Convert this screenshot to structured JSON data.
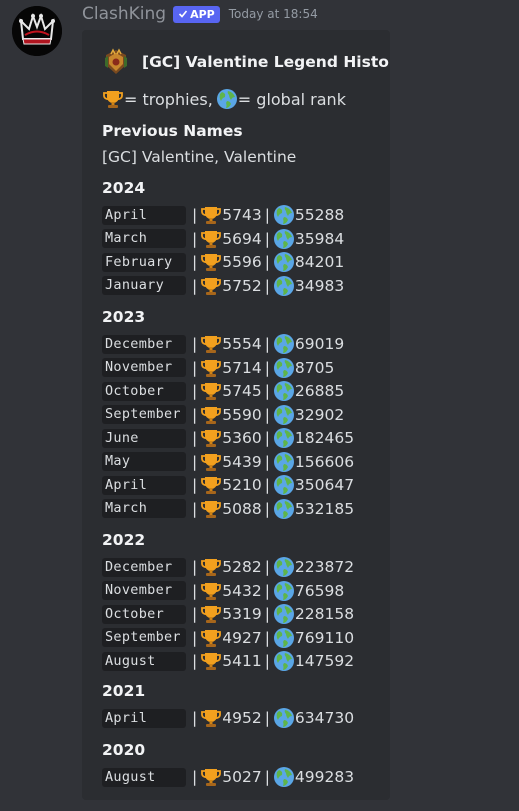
{
  "message": {
    "username": "ClashKing",
    "app_badge": "APP",
    "timestamp": "Today at 18:54"
  },
  "embed": {
    "title": "[GC] Valentine Legend History",
    "legend_trophies": "= trophies,",
    "legend_global": "= global rank",
    "previous_names_heading": "Previous Names",
    "previous_names": "[GC] Valentine, Valentine"
  },
  "history": [
    {
      "year": "2024",
      "rows": [
        {
          "month": "April",
          "trophies": "5743",
          "rank": "55288"
        },
        {
          "month": "March",
          "trophies": "5694",
          "rank": "35984"
        },
        {
          "month": "February",
          "trophies": "5596",
          "rank": "84201"
        },
        {
          "month": "January",
          "trophies": "5752",
          "rank": "34983"
        }
      ]
    },
    {
      "year": "2023",
      "rows": [
        {
          "month": "December",
          "trophies": "5554",
          "rank": "69019"
        },
        {
          "month": "November",
          "trophies": "5714",
          "rank": "8705"
        },
        {
          "month": "October",
          "trophies": "5745",
          "rank": "26885"
        },
        {
          "month": "September",
          "trophies": "5590",
          "rank": "32902"
        },
        {
          "month": "June",
          "trophies": "5360",
          "rank": "182465"
        },
        {
          "month": "May",
          "trophies": "5439",
          "rank": "156606"
        },
        {
          "month": "April",
          "trophies": "5210",
          "rank": "350647"
        },
        {
          "month": "March",
          "trophies": "5088",
          "rank": "532185"
        }
      ]
    },
    {
      "year": "2022",
      "rows": [
        {
          "month": "December",
          "trophies": "5282",
          "rank": "223872"
        },
        {
          "month": "November",
          "trophies": "5432",
          "rank": "76598"
        },
        {
          "month": "October",
          "trophies": "5319",
          "rank": "228158"
        },
        {
          "month": "September",
          "trophies": "4927",
          "rank": "769110"
        },
        {
          "month": "August",
          "trophies": "5411",
          "rank": "147592"
        }
      ]
    },
    {
      "year": "2021",
      "rows": [
        {
          "month": "April",
          "trophies": "4952",
          "rank": "634730"
        }
      ]
    },
    {
      "year": "2020",
      "rows": [
        {
          "month": "August",
          "trophies": "5027",
          "rank": "499283"
        }
      ]
    }
  ],
  "icons": {
    "avatar": "crown-icon",
    "title": "clan-badge-icon",
    "trophy": "trophy-icon",
    "global": "globe-icon",
    "app_check": "check-icon"
  },
  "colors": {
    "background": "#313338",
    "embed": "#2b2d31",
    "app_badge": "#5865f2",
    "code_bg": "#1e1f22"
  }
}
